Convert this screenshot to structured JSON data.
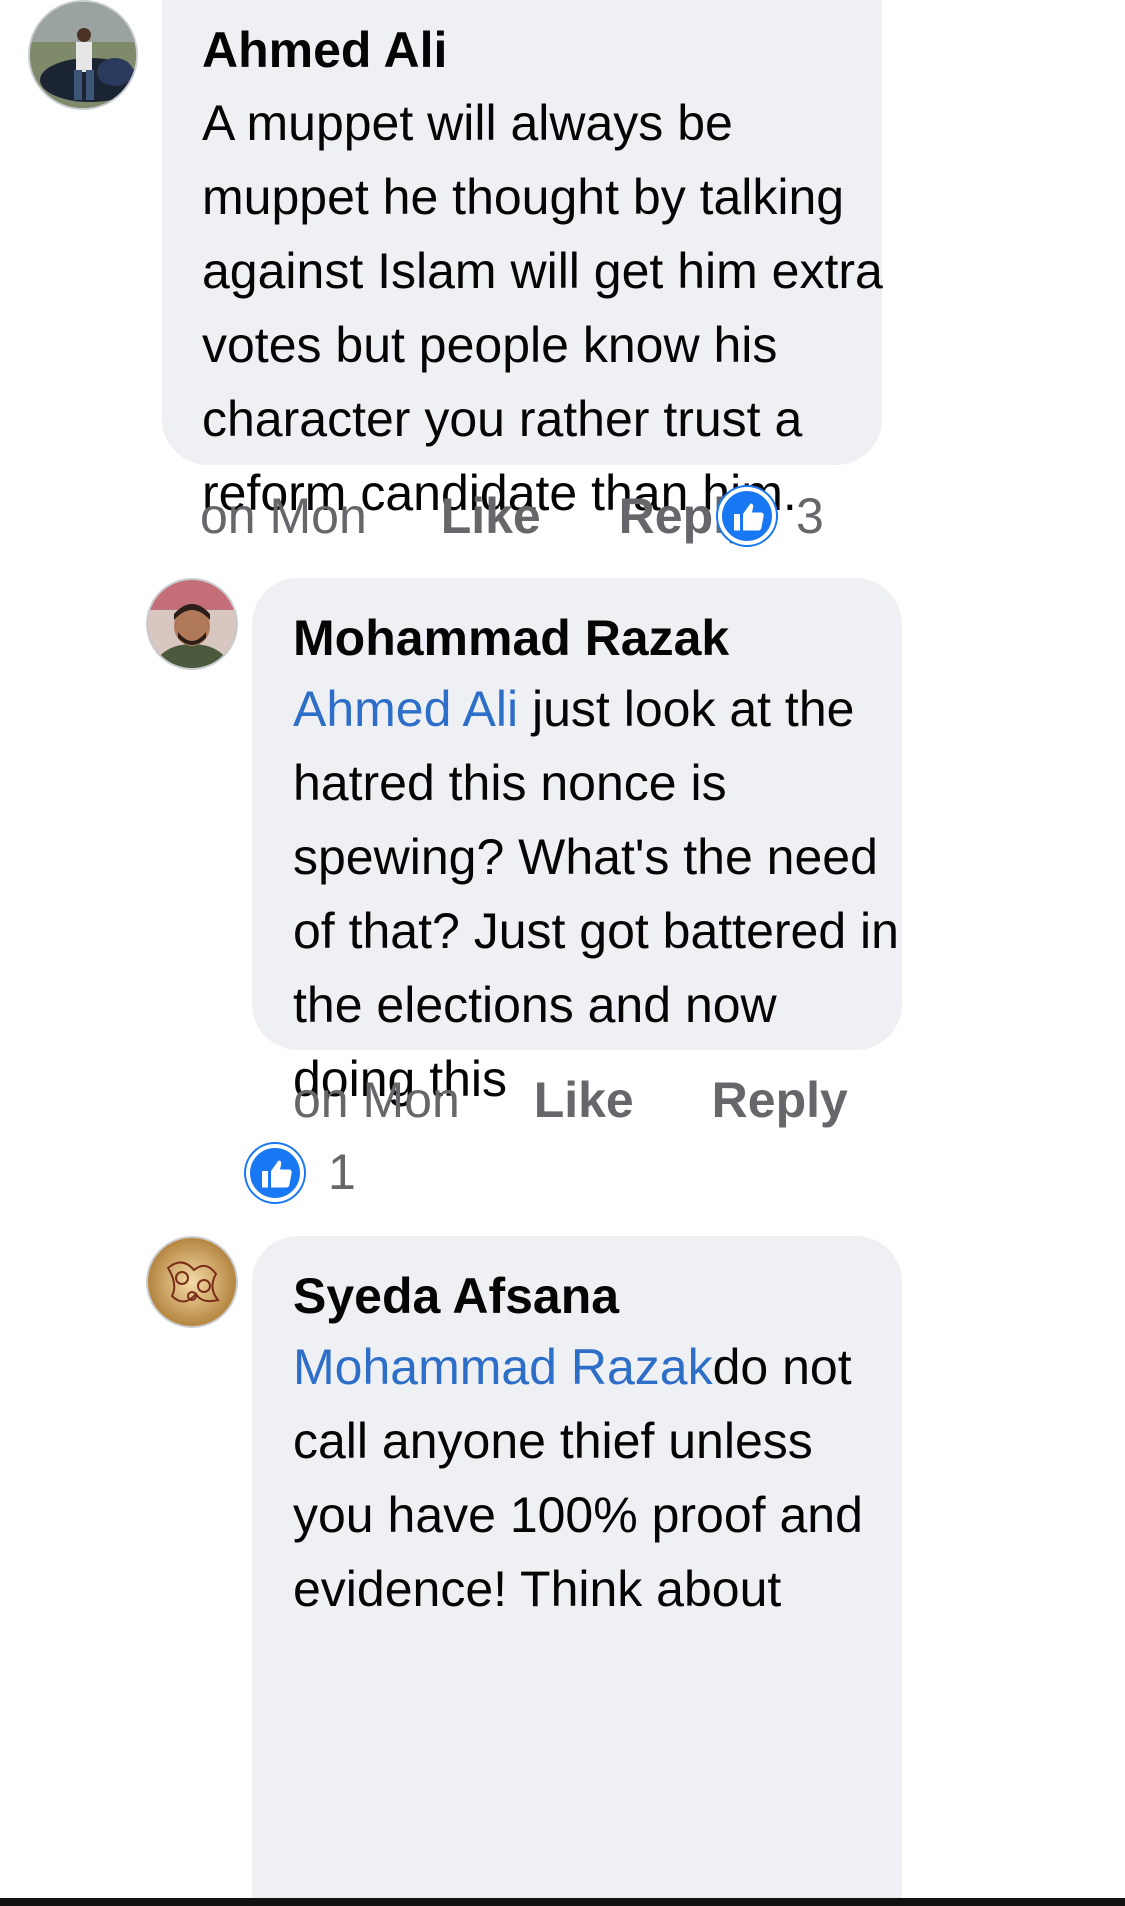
{
  "comments": [
    {
      "author": "Ahmed Ali",
      "lines": [
        "A muppet will always be",
        "muppet he thought by talking",
        "against Islam will get him extra",
        "votes but people know his",
        "character you rather trust a",
        "reform candidate than him."
      ],
      "time": "on Mon",
      "like_label": "Like",
      "reply_label": "Reply",
      "reaction_icon": "like-icon",
      "reaction_count": "3"
    },
    {
      "author": "Mohammad Razak",
      "mention": "Ahmed Ali",
      "first_line_rest": " just look at the",
      "lines": [
        "hatred this nonce is",
        "spewing? What's the need",
        "of that? Just got battered in",
        "the elections and now",
        "doing this"
      ],
      "time": "on Mon",
      "like_label": "Like",
      "reply_label": "Reply",
      "reaction_icon": "like-icon",
      "reaction_count": "1"
    },
    {
      "author": "Syeda Afsana",
      "mention": "Mohammad Razak",
      "first_line_rest": "do not",
      "lines": [
        "call anyone thief unless",
        "you have 100% proof and",
        "evidence! Think about"
      ]
    }
  ],
  "colors": {
    "bubble": "#eff0f4",
    "mention": "#2d6ec9",
    "meta": "#65676b",
    "like_blue": "#1877f2"
  }
}
